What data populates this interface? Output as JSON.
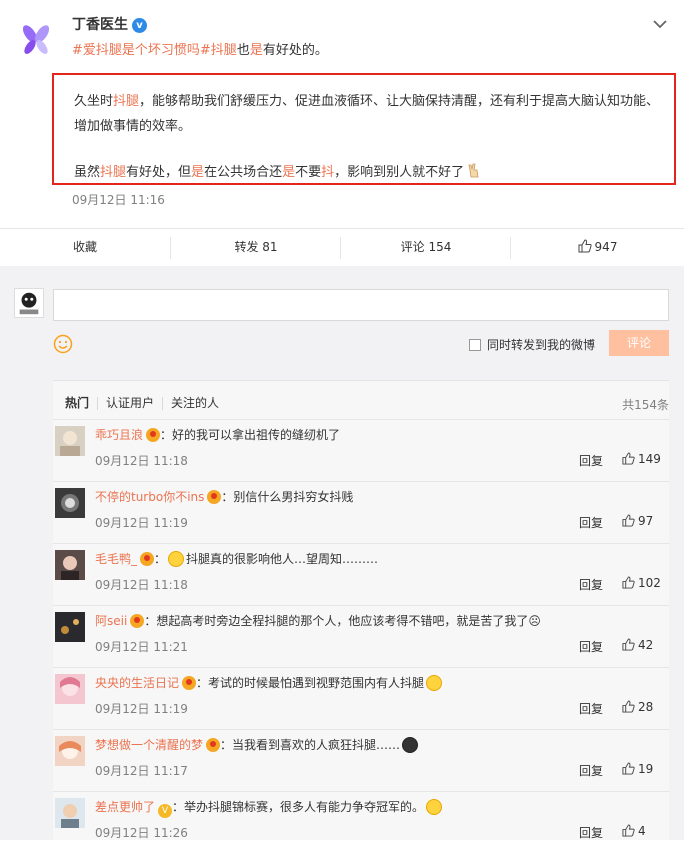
{
  "post": {
    "author": "丁香医生",
    "verify_icon": "v",
    "lead_tag": "#爱抖腿是个坏习惯吗#",
    "lead_hl1": "抖腿",
    "lead_mid": "也",
    "lead_hl2": "是",
    "lead_rest": "有好处的。",
    "p1_a": "久坐时",
    "p1_hl": "抖腿",
    "p1_b": "，能够帮助我们舒缓压力、促进血液循环、让大脑保持清醒，还有利于提高大脑认知功能、增加做事情的效率。",
    "p2_a": "虽然",
    "p2_hl1": "抖腿",
    "p2_b": "有好处，但",
    "p2_hl2": "是",
    "p2_c": "在公共场合还",
    "p2_hl3": "是",
    "p2_d": "不要",
    "p2_hl4": "抖",
    "p2_e": "，影响到别人就不好了",
    "timestamp": "09月12日 11:16"
  },
  "actions": {
    "favorite": "收藏",
    "forward": "转发 81",
    "comment": "评论 154",
    "like": "947"
  },
  "composer": {
    "forward_label": "同时转发到我的微博",
    "send_label": "评论"
  },
  "tabs": [
    "热门",
    "认证用户",
    "关注的人"
  ],
  "total": "共154条",
  "comments": [
    {
      "name": "乖巧且浪",
      "text": "：好的我可以拿出祖传的缝纫机了",
      "time": "09月12日 11:18",
      "reply": "回复",
      "likes": "149"
    },
    {
      "name": "不停的turbo你不ins",
      "text": "：别信什么男抖穷女抖贱",
      "time": "09月12日 11:19",
      "reply": "回复",
      "likes": "97"
    },
    {
      "name": "毛毛鸭_",
      "text": "抖腿真的很影响他人…望周知………",
      "time": "09月12日 11:18",
      "reply": "回复",
      "likes": "102"
    },
    {
      "name": "阿seii",
      "text": "：想起高考时旁边全程抖腿的那个人，他应该考得不错吧，就是苦了我了☹",
      "time": "09月12日 11:21",
      "reply": "回复",
      "likes": "42"
    },
    {
      "name": "央央的生活日记",
      "text": "：考试的时候最怕遇到视野范围内有人抖腿",
      "time": "09月12日 11:19",
      "reply": "回复",
      "likes": "28"
    },
    {
      "name": "梦想做一个清醒的梦",
      "text": "：当我看到喜欢的人疯狂抖腿……",
      "time": "09月12日 11:17",
      "reply": "回复",
      "likes": "19"
    },
    {
      "name": "差点更帅了",
      "text": "：举办抖腿锦标赛，很多人有能力争夺冠军的。",
      "time": "09月12日 11:26",
      "reply": "回复",
      "likes": "4"
    }
  ]
}
